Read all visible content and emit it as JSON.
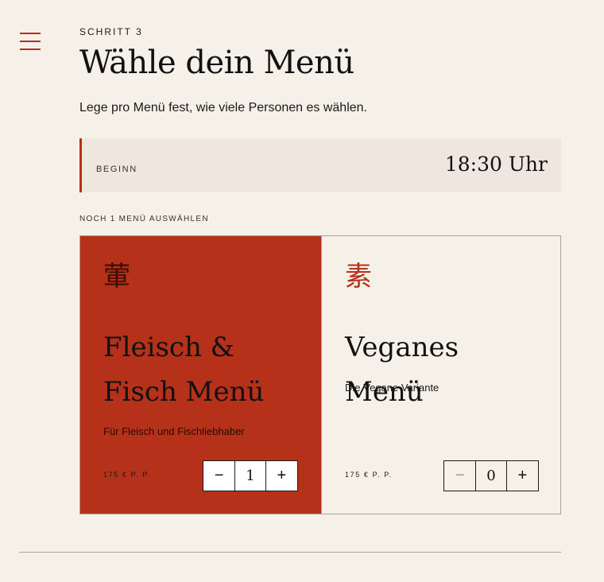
{
  "nav": {
    "menu_icon": "hamburger-menu-icon"
  },
  "header": {
    "step": "SCHRITT 3",
    "title": "Wähle dein Menü",
    "subtitle": "Lege pro Menü fest, wie viele Personen es wählen."
  },
  "start": {
    "label": "BEGINN",
    "time": "18:30 Uhr"
  },
  "selection": {
    "remaining": "NOCH 1 MENÜ AUSWÄHLEN",
    "menus": [
      {
        "glyph": "葷",
        "title": "Fleisch & Fisch Menü",
        "description": "Für Fleisch und Fischliebhaber",
        "price": "175 € P. P.",
        "quantity": "1",
        "minus": "−",
        "plus": "+",
        "selected": true
      },
      {
        "glyph": "素",
        "title": "Veganes Menü",
        "description": "Die Vegane Variante",
        "price": "175 € P. P.",
        "quantity": "0",
        "minus": "−",
        "plus": "+",
        "selected": false
      }
    ]
  },
  "colors": {
    "accent": "#b5311a",
    "background": "#f6f1e8",
    "start_box": "#efe7df",
    "border": "#a7a29a"
  }
}
